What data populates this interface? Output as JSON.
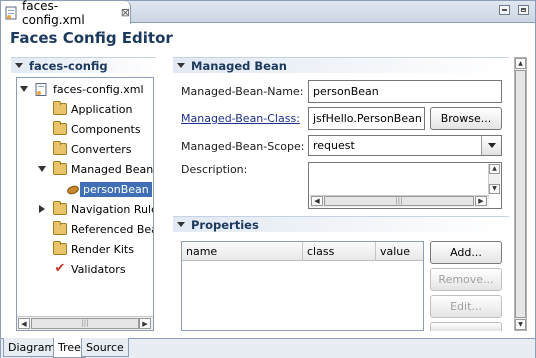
{
  "editor_tab": {
    "title": "faces-config.xml",
    "close_glyph": "⊠"
  },
  "window": {
    "minimize_icon": "minimize-icon",
    "maximize_icon": "maximize-icon"
  },
  "editor_title": "Faces Config Editor",
  "tree_section": {
    "header": "faces-config",
    "items": [
      {
        "label": "faces-config.xml",
        "icon": "xml-file-icon",
        "toggle": "open",
        "selected": false
      },
      {
        "label": "Application",
        "icon": "folder-icon",
        "toggle": "",
        "selected": false
      },
      {
        "label": "Components",
        "icon": "folder-icon",
        "toggle": "",
        "selected": false
      },
      {
        "label": "Converters",
        "icon": "folder-icon",
        "toggle": "",
        "selected": false
      },
      {
        "label": "Managed Beans",
        "icon": "folder-icon",
        "toggle": "open",
        "selected": false
      },
      {
        "label": "personBean",
        "icon": "bean-icon",
        "toggle": "",
        "selected": true
      },
      {
        "label": "Navigation Rules",
        "icon": "folder-icon",
        "toggle": "closed",
        "selected": false
      },
      {
        "label": "Referenced Bean",
        "icon": "folder-icon",
        "toggle": "",
        "selected": false
      },
      {
        "label": "Render Kits",
        "icon": "folder-icon",
        "toggle": "",
        "selected": false
      },
      {
        "label": "Validators",
        "icon": "check-icon",
        "toggle": "",
        "selected": false
      }
    ]
  },
  "managed_bean": {
    "header": "Managed Bean",
    "name_label": "Managed-Bean-Name:",
    "name_value": "personBean",
    "class_label": "Managed-Bean-Class:",
    "class_value": "jsfHello.PersonBean",
    "browse_button": "Browse...",
    "scope_label": "Managed-Bean-Scope:",
    "scope_value": "request",
    "description_label": "Description:",
    "description_value": ""
  },
  "properties": {
    "header": "Properties",
    "columns": [
      "name",
      "class",
      "value"
    ],
    "rows": [],
    "buttons": {
      "add": "Add...",
      "remove": "Remove...",
      "edit": "Edit..."
    }
  },
  "page_tabs": [
    "Diagram",
    "Tree",
    "Source"
  ],
  "active_page_tab": "Tree",
  "colors": {
    "title": "#1c3a5e",
    "selection": "#3f6fb4",
    "link": "#1c2f8c"
  }
}
